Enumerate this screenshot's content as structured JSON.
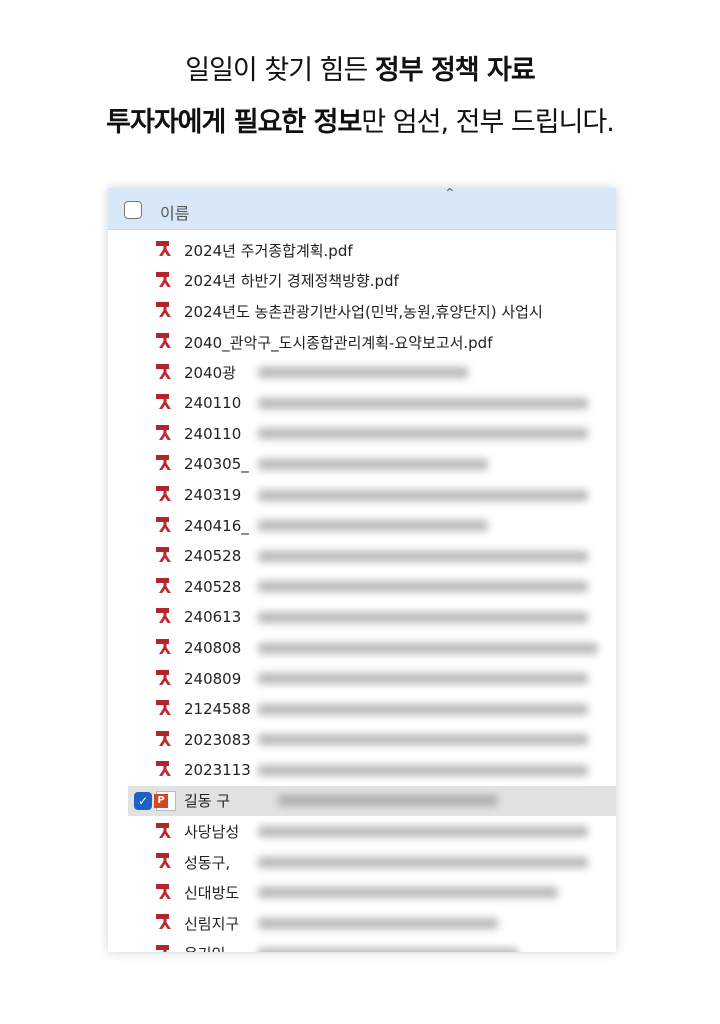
{
  "headline": {
    "line1_normal": "일일이 찾기 힘든 ",
    "line1_bold": "정부 정책 자료",
    "line2_bold": "투자자에게 필요한 정보",
    "line2_normal": "만 엄선, 전부 드립니다."
  },
  "explorer": {
    "column_header": "이름",
    "files": [
      {
        "name": "2024년 주거종합계획.pdf",
        "type": "pdf"
      },
      {
        "name": "2024년 하반기 경제정책방향.pdf",
        "type": "pdf"
      },
      {
        "name": "2024년도 농촌관광기반사업(민박,농원,휴양단지) 사업시",
        "type": "pdf"
      },
      {
        "name": "2040_관악구_도시종합관리계획-요약보고서.pdf",
        "type": "pdf"
      },
      {
        "name": "2040광",
        "type": "pdf"
      },
      {
        "name": "240110",
        "type": "pdf"
      },
      {
        "name": "240110",
        "type": "pdf"
      },
      {
        "name": "240305_",
        "type": "pdf"
      },
      {
        "name": "240319",
        "type": "pdf"
      },
      {
        "name": "240416_",
        "type": "pdf"
      },
      {
        "name": "240528",
        "type": "pdf"
      },
      {
        "name": "240528",
        "type": "pdf"
      },
      {
        "name": "240613",
        "type": "pdf"
      },
      {
        "name": "240808",
        "type": "pdf"
      },
      {
        "name": "240809",
        "type": "pdf"
      },
      {
        "name": "2124588",
        "type": "pdf"
      },
      {
        "name": "2023083",
        "type": "pdf"
      },
      {
        "name": "2023113",
        "type": "pdf"
      },
      {
        "name": "길동 구",
        "type": "ppt",
        "selected": true
      },
      {
        "name": "사당남성",
        "type": "pdf"
      },
      {
        "name": "성동구,",
        "type": "pdf"
      },
      {
        "name": "신대방도",
        "type": "pdf"
      },
      {
        "name": "신림지구",
        "type": "pdf"
      },
      {
        "name": "옥기인",
        "type": "pdf"
      }
    ]
  }
}
